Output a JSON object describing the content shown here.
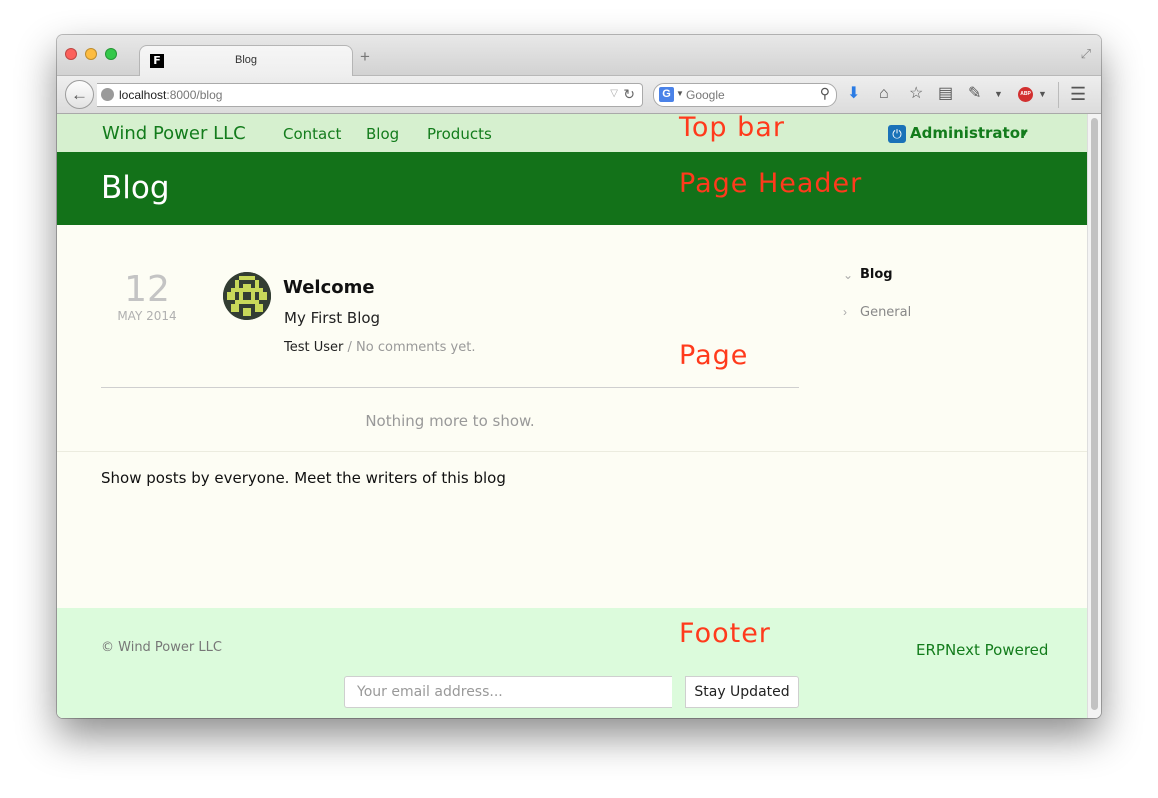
{
  "browser": {
    "tab_title": "Blog",
    "tab_favicon_letter": "F",
    "new_tab_symbol": "+",
    "url_host": "localhost",
    "url_rest": ":8000/blog",
    "search_placeholder": "Google",
    "search_engine_letter": "G",
    "abp_label": "ABP"
  },
  "icons": {
    "back": "back-arrow-icon",
    "globe": "globe-icon",
    "reload": "reload-icon",
    "search": "magnifier-icon",
    "download": "download-arrow-icon",
    "home": "home-icon",
    "bookmark": "star-icon",
    "reader": "clipboard-icon",
    "dev": "eyedropper-icon",
    "adblock": "adblock-icon",
    "menu": "hamburger-menu-icon",
    "power": "power-icon"
  },
  "topbar": {
    "brand": "Wind Power LLC",
    "links": [
      "Contact",
      "Blog",
      "Products"
    ],
    "user": "Administrator"
  },
  "annotations": {
    "top_bar": "Top bar",
    "page_header": "Page Header",
    "page": "Page",
    "footer": "Footer"
  },
  "header": {
    "title": "Blog"
  },
  "post": {
    "day": "12",
    "month_year": "MAY 2014",
    "title": "Welcome",
    "blog": "My First Blog",
    "author": "Test User",
    "separator": "/",
    "comments": "No comments yet."
  },
  "pager": {
    "nothing_more": "Nothing more to show."
  },
  "sidebar": {
    "items": [
      "Blog",
      "General"
    ]
  },
  "writers_note": "Show posts by everyone. Meet the writers of this blog",
  "footer": {
    "copyright": "© Wind Power LLC",
    "powered": "ERPNext Powered",
    "email_placeholder": "Your email address...",
    "subscribe_label": "Stay Updated"
  },
  "colors": {
    "topbar_bg": "#d6f0cf",
    "header_bg": "#137219",
    "brand_green": "#137c1c",
    "page_bg": "#fdfdf4",
    "footer_bg": "#dcfbdc",
    "annotation_red": "#ff3a1c"
  }
}
